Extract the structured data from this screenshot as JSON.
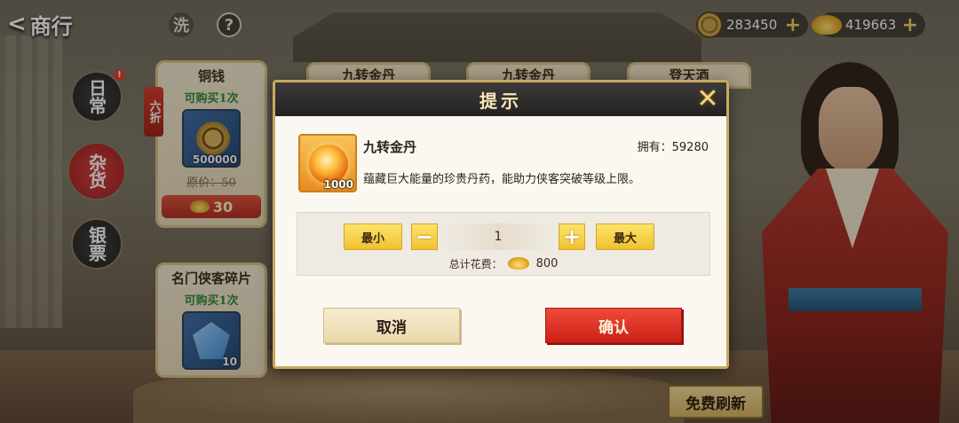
{
  "topbar": {
    "back_label": "商行",
    "icon1": "洗",
    "icon2": "?",
    "currency_copper": "283450",
    "currency_gold": "419663",
    "plus": "+"
  },
  "side_tabs": {
    "daily": "日常",
    "misc": "杂货",
    "silver": "银票",
    "badge": "!"
  },
  "cards": {
    "copper": {
      "title": "铜钱",
      "limit": "可购买1次",
      "qty": "500000",
      "old_price": "原价：50",
      "price": "30",
      "discount": "六折"
    },
    "shard": {
      "title": "名门侠客碎片",
      "limit": "可购买1次",
      "qty": "10"
    },
    "bg_titles": [
      "九转金丹",
      "九转金丹",
      "登天酒"
    ]
  },
  "refresh_label": "免费刷新",
  "modal": {
    "title": "提示",
    "close": "✕",
    "item_name": "九转金丹",
    "owned": "拥有：59280",
    "item_count": "1000",
    "description": "蕴藏巨大能量的珍贵丹药，能助力侠客突破等级上限。",
    "min_label": "最小",
    "max_label": "最大",
    "minus": "−",
    "plus": "+",
    "quantity": "1",
    "total_label": "总计花费：",
    "total_amount": "800",
    "cancel_label": "取消",
    "confirm_label": "确认"
  },
  "colors": {
    "modal_header": "#242221",
    "accent_gold": "#f0c132",
    "confirm_red": "#cc1f16"
  }
}
